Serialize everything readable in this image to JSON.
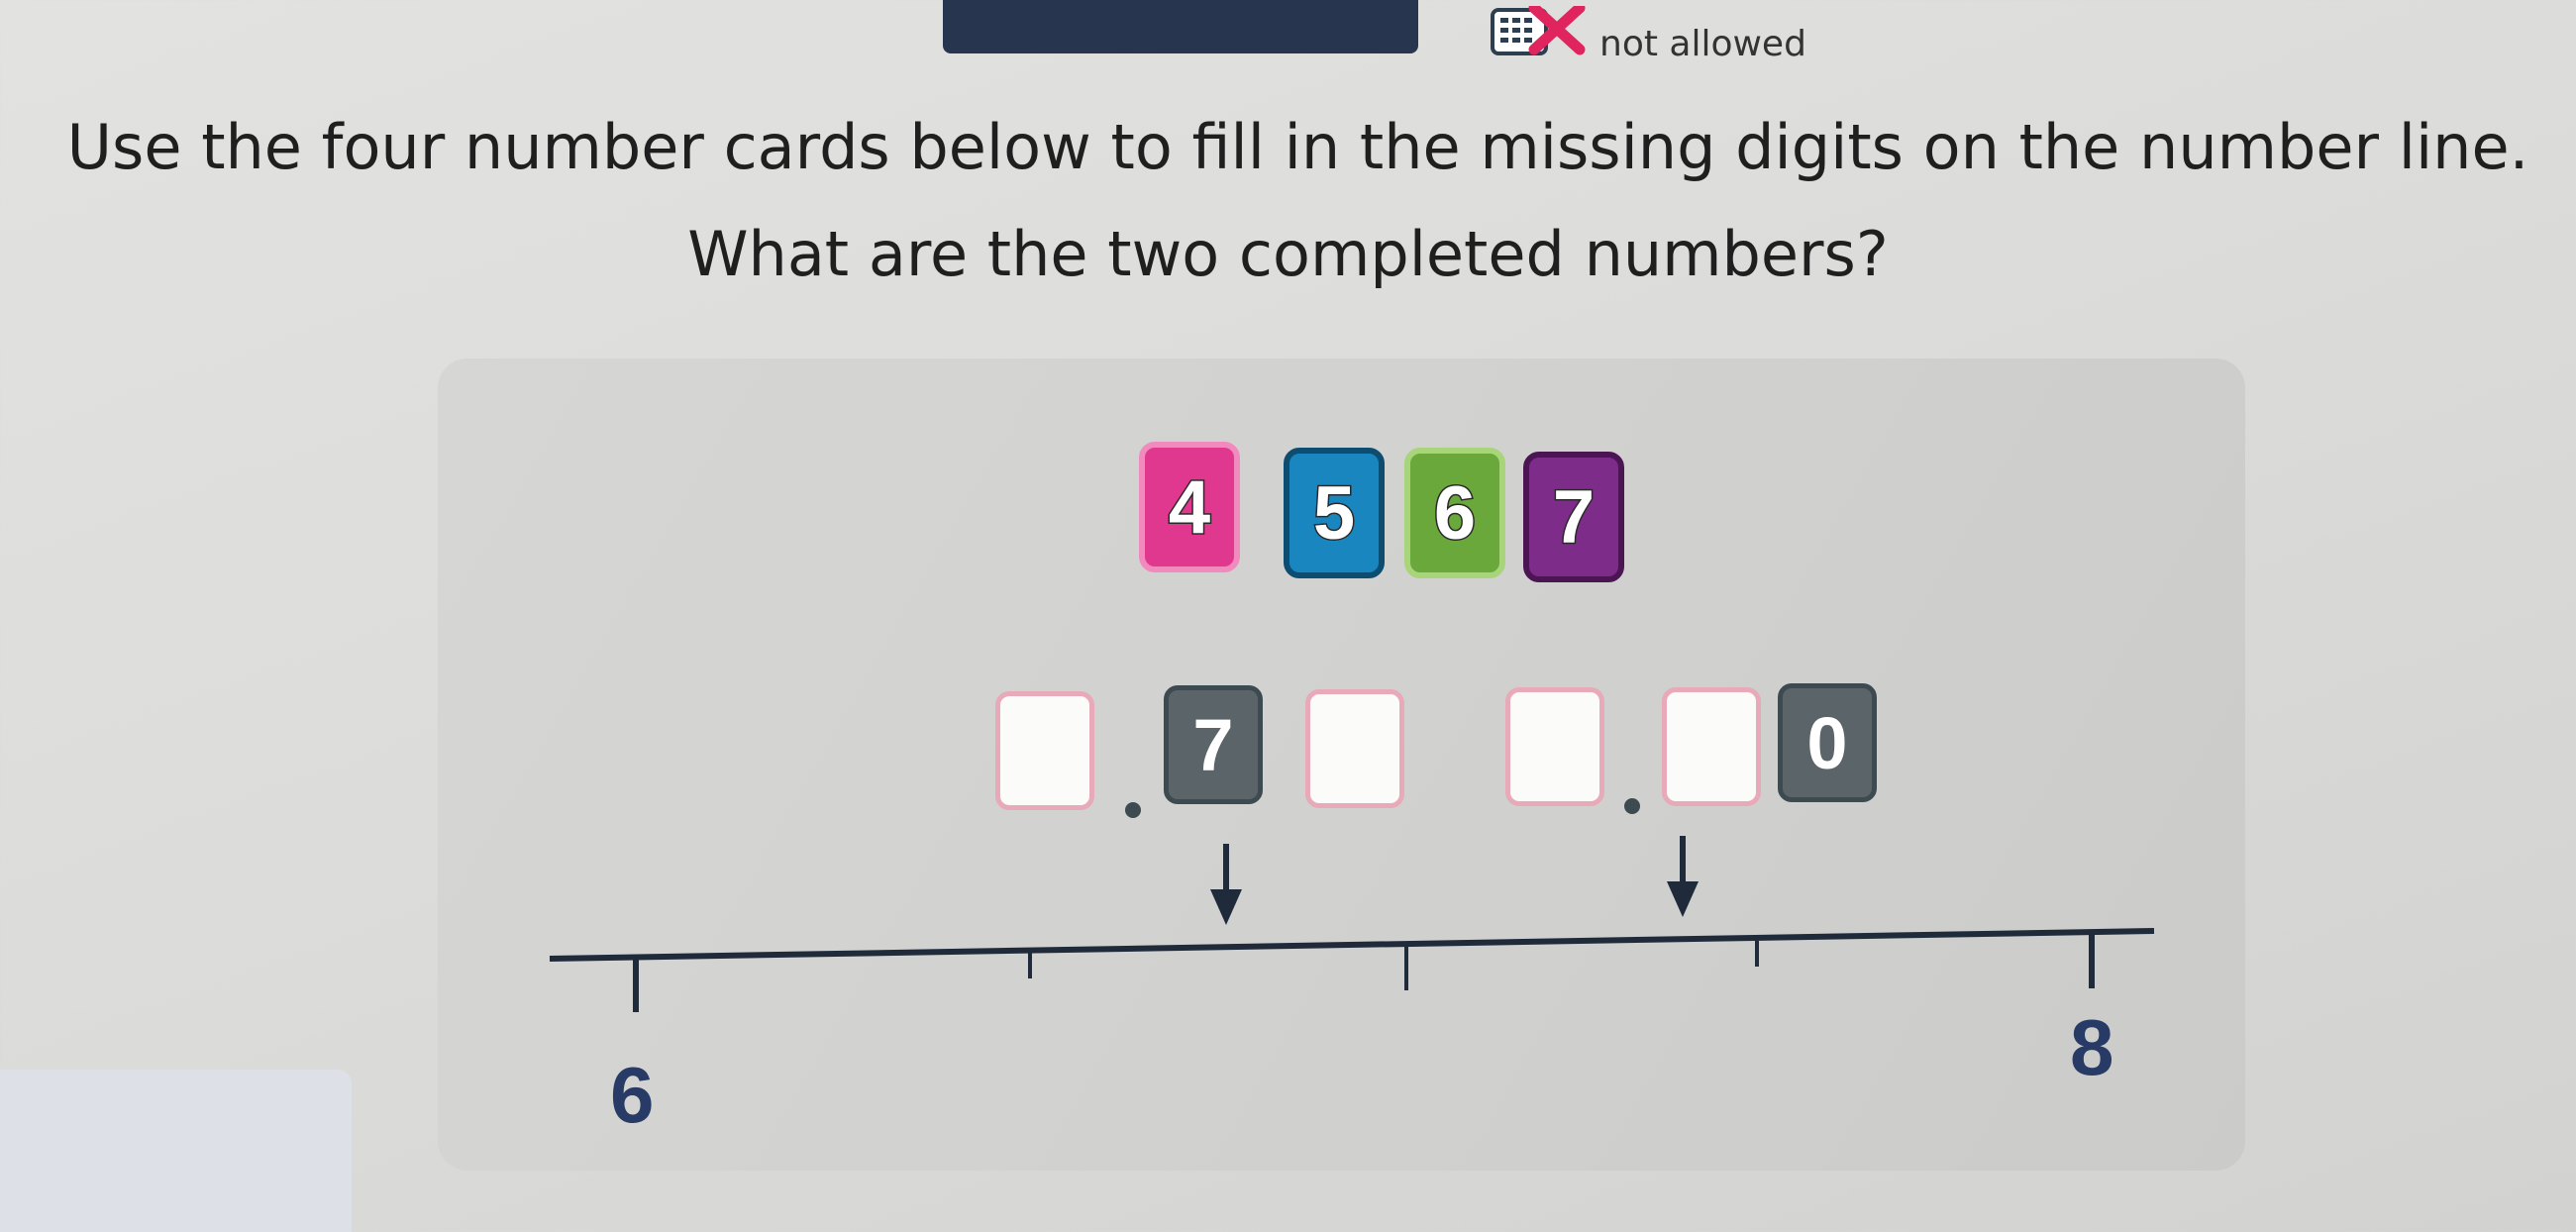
{
  "toolbar": {
    "calculator_status": "not allowed",
    "calculator_icon": "calculator-crossed-icon",
    "status_color": "#e0245e"
  },
  "question": {
    "line1": "Use the four number cards below to fill in the missing digits on the number line.",
    "line2": "What are the two completed numbers?"
  },
  "number_cards": [
    {
      "digit": "4",
      "color": "#e0388f"
    },
    {
      "digit": "5",
      "color": "#1a86bf"
    },
    {
      "digit": "6",
      "color": "#6aa83b"
    },
    {
      "digit": "7",
      "color": "#7d2c8a"
    }
  ],
  "first_number": {
    "integer_digit": "",
    "tenths_digit": "7",
    "hundredths_digit": ""
  },
  "second_number": {
    "integer_digit": "",
    "tenths_digit": "",
    "hundredths_digit": "0"
  },
  "number_line": {
    "start_label": "6",
    "end_label": "8",
    "start_value": 6,
    "end_value": 8,
    "minor_divisions": 4
  }
}
